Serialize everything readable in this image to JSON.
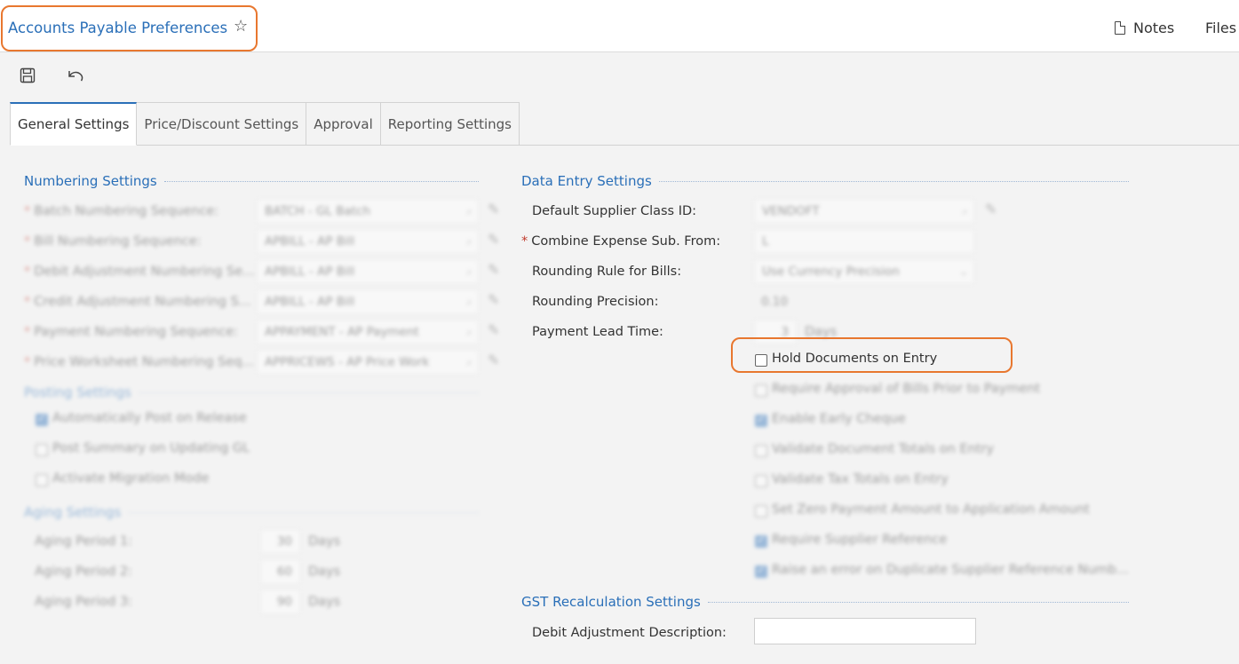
{
  "header": {
    "title": "Accounts Payable Preferences",
    "notes": "Notes",
    "files": "Files"
  },
  "tabs": [
    "General Settings",
    "Price/Discount Settings",
    "Approval",
    "Reporting Settings"
  ],
  "numbering": {
    "title": "Numbering Settings",
    "rows": [
      {
        "label": "Batch Numbering Sequence:",
        "value": "BATCH - GL Batch"
      },
      {
        "label": "Bill Numbering Sequence:",
        "value": "APBILL - AP Bill"
      },
      {
        "label": "Debit Adjustment Numbering Se...",
        "value": "APBILL - AP Bill"
      },
      {
        "label": "Credit Adjustment Numbering S...",
        "value": "APBILL - AP Bill"
      },
      {
        "label": "Payment Numbering Sequence:",
        "value": "APPAYMENT - AP Payment"
      },
      {
        "label": "Price Worksheet Numbering Seq...",
        "value": "APPRICEWS - AP Price Work"
      }
    ]
  },
  "posting": {
    "title": "Posting Settings",
    "items": [
      {
        "label": "Automatically Post on Release",
        "checked": true
      },
      {
        "label": "Post Summary on Updating GL",
        "checked": false
      },
      {
        "label": "Activate Migration Mode",
        "checked": false
      }
    ]
  },
  "aging": {
    "title": "Aging Settings",
    "rows": [
      {
        "label": "Aging Period 1:",
        "value": "30",
        "unit": "Days"
      },
      {
        "label": "Aging Period 2:",
        "value": "60",
        "unit": "Days"
      },
      {
        "label": "Aging Period 3:",
        "value": "90",
        "unit": "Days"
      }
    ]
  },
  "data_entry": {
    "title": "Data Entry Settings",
    "supplier_class_label": "Default Supplier Class ID:",
    "supplier_class_value": "VENDOFT",
    "combine_label": "Combine Expense Sub. From:",
    "combine_value": "L",
    "rounding_rule_label": "Rounding Rule for Bills:",
    "rounding_rule_value": "Use Currency Precision",
    "rounding_precision_label": "Rounding Precision:",
    "rounding_precision_value": "0.10",
    "lead_time_label": "Payment Lead Time:",
    "lead_time_value": "3",
    "lead_time_unit": "Days",
    "checkboxes": [
      {
        "label": "Hold Documents on Entry",
        "checked": false
      },
      {
        "label": "Require Approval of Bills Prior to Payment",
        "checked": false
      },
      {
        "label": "Enable Early Cheque",
        "checked": true
      },
      {
        "label": "Validate Document Totals on Entry",
        "checked": false
      },
      {
        "label": "Validate Tax Totals on Entry",
        "checked": false
      },
      {
        "label": "Set Zero Payment Amount to Application Amount",
        "checked": false
      },
      {
        "label": "Require Supplier Reference",
        "checked": true
      },
      {
        "label": "Raise an error on Duplicate Supplier Reference Numb...",
        "checked": true
      }
    ]
  },
  "gst": {
    "title": "GST Recalculation Settings",
    "debit_label": "Debit Adjustment Description:",
    "debit_value": ""
  }
}
